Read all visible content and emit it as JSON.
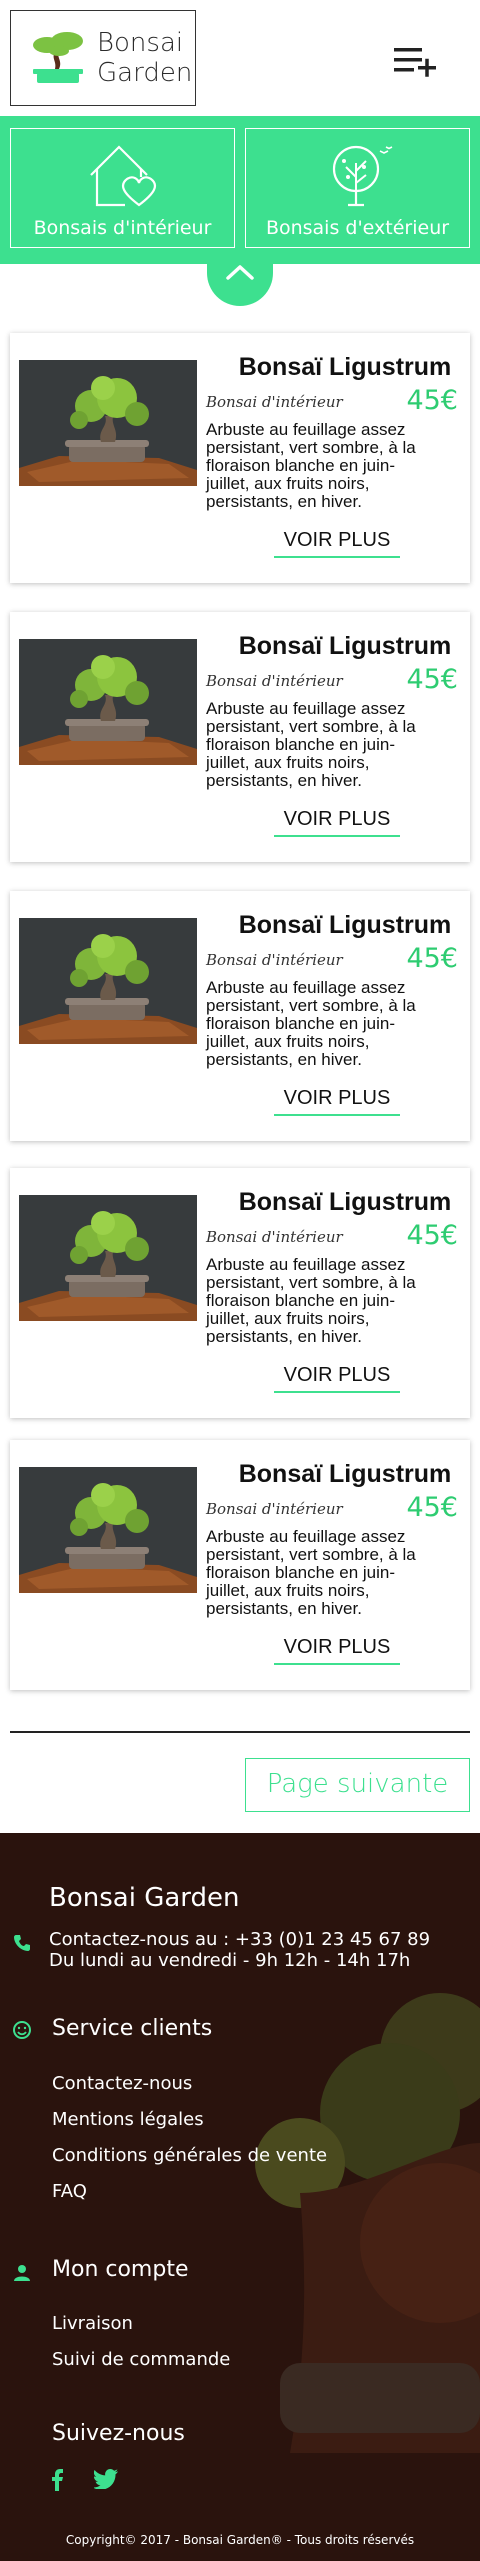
{
  "brand": {
    "line1": "Bonsai",
    "line2": "Garden"
  },
  "categories": [
    {
      "label": "Bonsais d'intérieur",
      "icon": "house-heart-icon"
    },
    {
      "label": "Bonsais d'extérieur",
      "icon": "tree-icon"
    }
  ],
  "products": [
    {
      "title": "Bonsaï Ligustrum",
      "category": "Bonsai d'intérieur",
      "price": "45€",
      "desc": [
        "Arbuste au feuillage assez",
        "persistant, vert sombre, à la",
        "floraison blanche en juin-",
        "juillet, aux fruits noirs,",
        "persistants, en  hiver."
      ],
      "more": "VOIR PLUS"
    },
    {
      "title": "Bonsaï Ligustrum",
      "category": "Bonsai d'intérieur",
      "price": "45€",
      "desc": [
        "Arbuste au feuillage assez",
        "persistant, vert sombre, à la",
        "floraison blanche en juin-",
        "juillet, aux fruits noirs,",
        "persistants, en  hiver."
      ],
      "more": "VOIR PLUS"
    },
    {
      "title": "Bonsaï Ligustrum",
      "category": "Bonsai d'intérieur",
      "price": "45€",
      "desc": [
        "Arbuste au feuillage assez",
        "persistant, vert sombre, à la",
        "floraison blanche en juin-",
        "juillet, aux fruits noirs,",
        "persistants, en  hiver."
      ],
      "more": "VOIR PLUS"
    },
    {
      "title": "Bonsaï Ligustrum",
      "category": "Bonsai d'intérieur",
      "price": "45€",
      "desc": [
        "Arbuste au feuillage assez",
        "persistant, vert sombre, à la",
        "floraison blanche en juin-",
        "juillet, aux fruits noirs,",
        "persistants, en  hiver."
      ],
      "more": "VOIR PLUS"
    },
    {
      "title": "Bonsaï Ligustrum",
      "category": "Bonsai d'intérieur",
      "price": "45€",
      "desc": [
        "Arbuste au feuillage assez",
        "persistant, vert sombre, à la",
        "floraison blanche en juin-",
        "juillet, aux fruits noirs,",
        "persistants, en  hiver."
      ],
      "more": "VOIR PLUS"
    }
  ],
  "pagination": {
    "next_label": "Page suivante"
  },
  "footer": {
    "brand": "Bonsai Garden",
    "contact_line1": "Contactez-nous au : +33 (0)1 23 45 67 89",
    "contact_line2": "Du lundi au vendredi - 9h 12h - 14h 17h",
    "service": {
      "heading": "Service clients",
      "links": [
        "Contactez-nous",
        "Mentions légales",
        "Conditions générales de vente",
        "FAQ"
      ]
    },
    "account": {
      "heading": "Mon compte",
      "links": [
        "Livraison",
        "Suivi de commande"
      ]
    },
    "follow": {
      "heading": "Suivez-nous"
    },
    "copyright": "Copyright© 2017 - Bonsai Garden® - Tous droits réservés"
  },
  "colors": {
    "accent": "#3de08f",
    "price": "#2ecc71",
    "footer_bg": "#2a130d"
  }
}
